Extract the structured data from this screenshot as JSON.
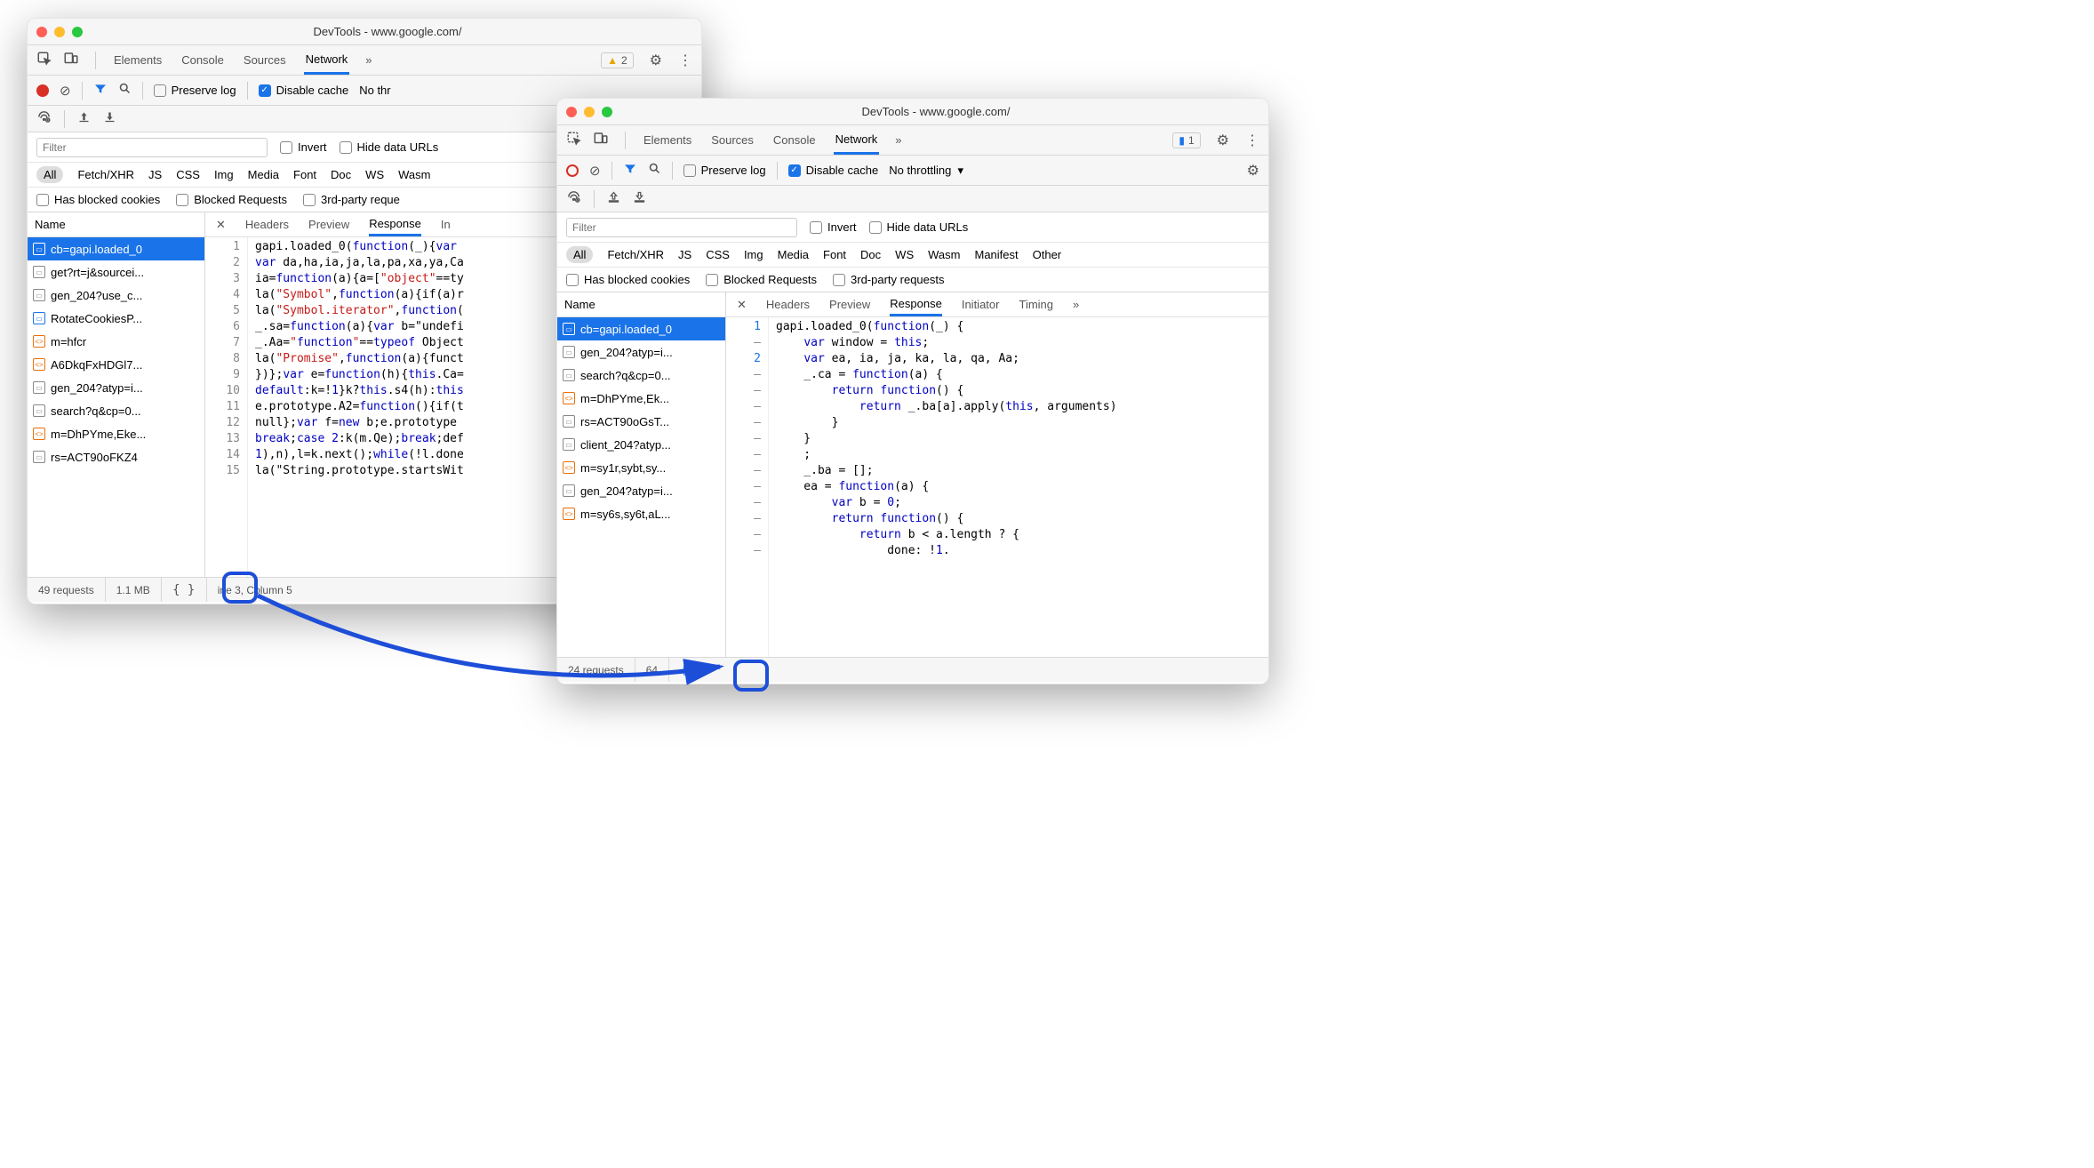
{
  "window_left": {
    "title": "DevTools - www.google.com/",
    "tabs": [
      "Elements",
      "Console",
      "Sources",
      "Network"
    ],
    "active_tab": "Network",
    "warning_count": "2",
    "preserve_log_label": "Preserve log",
    "disable_cache_label": "Disable cache",
    "throttling_label": "No thr",
    "filter_placeholder": "Filter",
    "invert_label": "Invert",
    "hide_data_urls_label": "Hide data URLs",
    "type_filters": [
      "All",
      "Fetch/XHR",
      "JS",
      "CSS",
      "Img",
      "Media",
      "Font",
      "Doc",
      "WS",
      "Wasm"
    ],
    "has_blocked_cookies_label": "Has blocked cookies",
    "blocked_requests_label": "Blocked Requests",
    "third_party_label": "3rd-party reque",
    "name_header": "Name",
    "detail_tabs": [
      "Headers",
      "Preview",
      "Response",
      "In"
    ],
    "active_detail_tab": "Response",
    "files": [
      {
        "name": "cb=gapi.loaded_0",
        "icon": "grey",
        "selected": true
      },
      {
        "name": "get?rt=j&sourcei...",
        "icon": "grey"
      },
      {
        "name": "gen_204?use_c...",
        "icon": "grey"
      },
      {
        "name": "RotateCookiesP...",
        "icon": "blue"
      },
      {
        "name": "m=hfcr",
        "icon": "orange"
      },
      {
        "name": "A6DkqFxHDGl7...",
        "icon": "orange"
      },
      {
        "name": "gen_204?atyp=i...",
        "icon": "grey"
      },
      {
        "name": "search?q&cp=0...",
        "icon": "grey"
      },
      {
        "name": "m=DhPYme,Eke...",
        "icon": "orange"
      },
      {
        "name": "rs=ACT90oFKZ4",
        "icon": "grey"
      }
    ],
    "code_lines": [
      "gapi.loaded_0(function(_){var ",
      "var da,ha,ia,ja,la,pa,xa,ya,Ca",
      "ia=function(a){a=[\"object\"==ty",
      "la(\"Symbol\",function(a){if(a)r",
      "la(\"Symbol.iterator\",function(",
      "_.sa=function(a){var b=\"undefi",
      "_.Aa=\"function\"==typeof Object",
      "la(\"Promise\",function(a){funct",
      "})};var e=function(h){this.Ca=",
      "default:k=!1}k?this.s4(h):this",
      "e.prototype.A2=function(){if(t",
      "null};var f=new b;e.prototype",
      "break;case 2:k(m.Qe);break;def",
      "1),n),l=k.next();while(!l.done",
      "la(\"String.prototype.startsWit"
    ],
    "gutter": [
      "1",
      "2",
      "3",
      "4",
      "5",
      "6",
      "7",
      "8",
      "9",
      "10",
      "11",
      "12",
      "13",
      "14",
      "15"
    ],
    "status_requests": "49 requests",
    "status_size": "1.1 MB",
    "status_cursor": "ine 3, Column 5"
  },
  "window_right": {
    "title": "DevTools - www.google.com/",
    "tabs": [
      "Elements",
      "Sources",
      "Console",
      "Network"
    ],
    "active_tab": "Network",
    "message_count": "1",
    "preserve_log_label": "Preserve log",
    "disable_cache_label": "Disable cache",
    "throttling_label": "No throttling",
    "filter_placeholder": "Filter",
    "invert_label": "Invert",
    "hide_data_urls_label": "Hide data URLs",
    "type_filters": [
      "All",
      "Fetch/XHR",
      "JS",
      "CSS",
      "Img",
      "Media",
      "Font",
      "Doc",
      "WS",
      "Wasm",
      "Manifest",
      "Other"
    ],
    "has_blocked_cookies_label": "Has blocked cookies",
    "blocked_requests_label": "Blocked Requests",
    "third_party_label": "3rd-party requests",
    "name_header": "Name",
    "detail_tabs": [
      "Headers",
      "Preview",
      "Response",
      "Initiator",
      "Timing"
    ],
    "active_detail_tab": "Response",
    "files": [
      {
        "name": "cb=gapi.loaded_0",
        "icon": "grey",
        "selected": true
      },
      {
        "name": "gen_204?atyp=i...",
        "icon": "grey"
      },
      {
        "name": "search?q&cp=0...",
        "icon": "grey"
      },
      {
        "name": "m=DhPYme,Ek...",
        "icon": "orange"
      },
      {
        "name": "rs=ACT90oGsT...",
        "icon": "grey"
      },
      {
        "name": "client_204?atyp...",
        "icon": "grey"
      },
      {
        "name": "m=sy1r,sybt,sy...",
        "icon": "orange"
      },
      {
        "name": "gen_204?atyp=i...",
        "icon": "grey"
      },
      {
        "name": "m=sy6s,sy6t,aL...",
        "icon": "orange"
      }
    ],
    "code_lines": [
      "gapi.loaded_0(function(_) {",
      "    var window = this;",
      "    var ea, ia, ja, ka, la, qa, Aa;",
      "    _.ca = function(a) {",
      "        return function() {",
      "            return _.ba[a].apply(this, arguments)",
      "        }",
      "    }",
      "    ;",
      "    _.ba = [];",
      "    ea = function(a) {",
      "        var b = 0;",
      "        return function() {",
      "            return b < a.length ? {",
      "                done: !1."
    ],
    "gutter": [
      "1",
      "–",
      "2",
      "–",
      "–",
      "–",
      "–",
      "–",
      "–",
      "–",
      "–",
      "–",
      "–",
      "–",
      "–"
    ],
    "status_requests": "24 requests",
    "status_size": "64"
  }
}
